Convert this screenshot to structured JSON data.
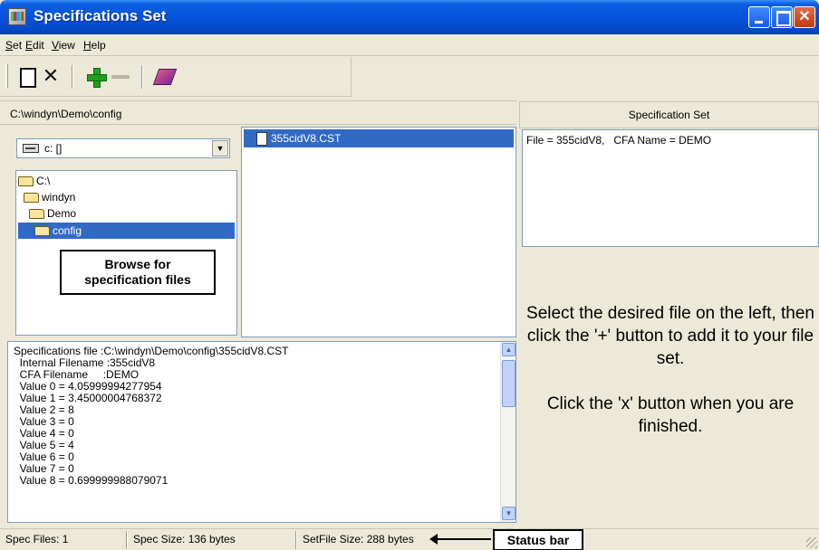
{
  "window": {
    "title": "Specifications Set",
    "title_icon": "app-icon"
  },
  "menu": [
    {
      "label": "Set",
      "accel": "S"
    },
    {
      "label": "Edit",
      "accel": "E"
    },
    {
      "label": "View",
      "accel": "V"
    },
    {
      "label": "Help",
      "accel": "H"
    }
  ],
  "toolbar": {
    "new_icon": "new-document-icon",
    "delete_glyph": "✕",
    "add_icon": "plus-icon",
    "remove_icon": "minus-icon",
    "book_icon": "book-icon"
  },
  "browser": {
    "path": "C:\\windyn\\Demo\\config",
    "drive": "c: []",
    "folders": [
      "C:\\",
      "windyn",
      "Demo",
      "config"
    ],
    "selected_folder": "config",
    "callout": [
      "Browse for",
      "specification files"
    ]
  },
  "file_list": {
    "files": [
      "355cidV8.CST"
    ]
  },
  "details": {
    "lines": [
      "Specifications file :C:\\windyn\\Demo\\config\\355cidV8.CST",
      "  Internal Filename :355cidV8",
      "  CFA Filename     :DEMO",
      "  Value 0 = 4.05999994277954",
      "  Value 1 = 3.45000004768372",
      "  Value 2 = 8",
      "  Value 3 = 0",
      "  Value 4 = 0",
      "  Value 5 = 4",
      "  Value 6 = 0",
      "  Value 7 = 0",
      "  Value 8 = 0.699999988079071"
    ]
  },
  "spec_set": {
    "header": "Specification Set",
    "entries": [
      "File = 355cidV8,   CFA Name = DEMO"
    ]
  },
  "instructions": {
    "para1": "Select the desired file on the left, then click the '+' button to add it to your file set.",
    "para2": "Click the 'x' button when you are finished."
  },
  "status": {
    "spec_files": "Spec Files: 1",
    "spec_size": "Spec Size: 136 bytes",
    "setfile_size": "SetFile Size: 288 bytes",
    "callout": "Status bar"
  }
}
